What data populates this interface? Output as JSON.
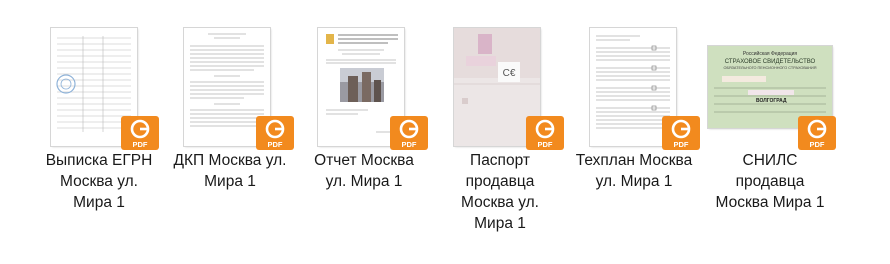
{
  "files": [
    {
      "name_lines": [
        "Выписка ЕГРН",
        "Москва ул.",
        "Мира 1"
      ],
      "icon": "pdf-file-icon",
      "badge": "PDF"
    },
    {
      "name_lines": [
        "ДКП Москва ул.",
        "Мира 1"
      ],
      "icon": "pdf-file-icon",
      "badge": "PDF"
    },
    {
      "name_lines": [
        "Отчет Москва",
        "ул. Мира 1"
      ],
      "icon": "pdf-file-icon",
      "badge": "PDF"
    },
    {
      "name_lines": [
        "Паспорт",
        "продавца",
        "Москва ул.",
        "Мира 1"
      ],
      "icon": "pdf-file-icon",
      "badge": "PDF"
    },
    {
      "name_lines": [
        "Техплан Москва",
        "ул. Мира 1"
      ],
      "icon": "pdf-file-icon",
      "badge": "PDF"
    },
    {
      "name_lines": [
        "СНИЛС",
        "продавца",
        "Москва Мира 1"
      ],
      "icon": "pdf-file-icon",
      "badge": "PDF"
    }
  ],
  "snils_card": {
    "country": "Российская Федерация",
    "title": "СТРАХОВОЕ СВИДЕТЕЛЬСТВО",
    "subtitle": "ОБЯЗАТЕЛЬНОГО ПЕНСИОННОГО СТРАХОВАНИЯ",
    "city": "ВОЛГОГРАД"
  },
  "colors": {
    "pdf_badge": "#f28a1e",
    "card_green": "#cfe0bf"
  }
}
